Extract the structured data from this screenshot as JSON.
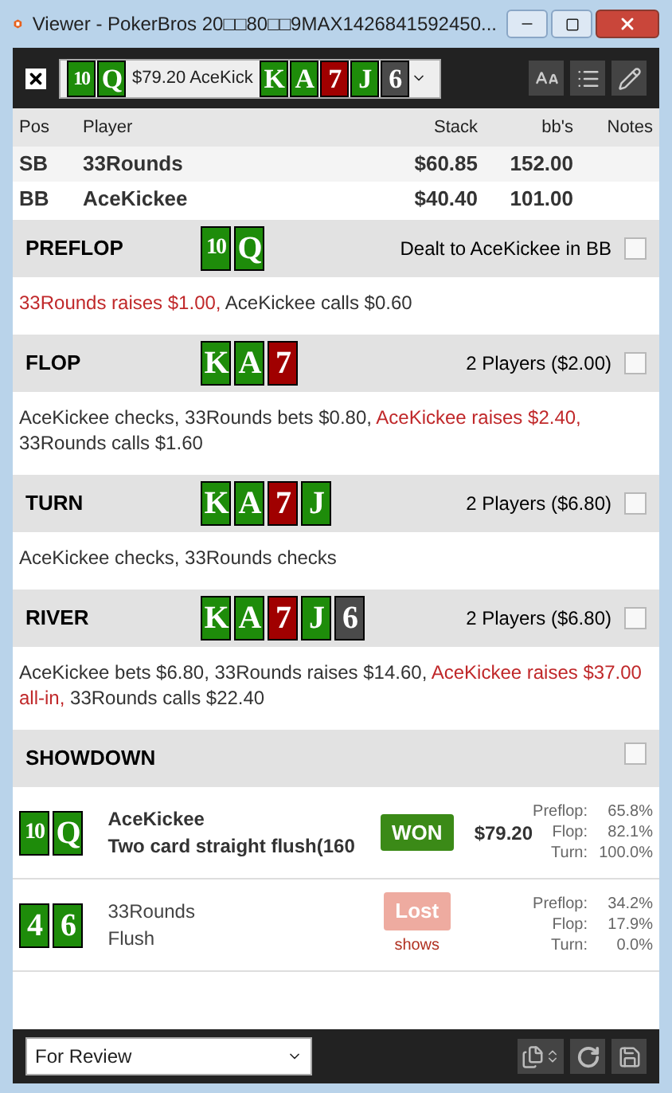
{
  "window": {
    "title": "Viewer - PokerBros 20□□80□□9MAX1426841592450..."
  },
  "toolbar": {
    "hand_selector": {
      "hole_cards": [
        {
          "rank": "10",
          "color": "#1e8c0a"
        },
        {
          "rank": "Q",
          "color": "#1e8c0a"
        }
      ],
      "label": "$79.20 AceKick",
      "board": [
        {
          "rank": "K",
          "color": "#1e8c0a"
        },
        {
          "rank": "A",
          "color": "#1e8c0a"
        },
        {
          "rank": "7",
          "color": "#a00000"
        },
        {
          "rank": "J",
          "color": "#1e8c0a"
        },
        {
          "rank": "6",
          "color": "#4a4a4a"
        }
      ]
    }
  },
  "players_table": {
    "columns": [
      "Pos",
      "Player",
      "Stack",
      "bb's",
      "Notes"
    ],
    "rows": [
      {
        "pos": "SB",
        "player": "33Rounds",
        "stack": "$60.85",
        "bbs": "152.00"
      },
      {
        "pos": "BB",
        "player": "AceKickee",
        "stack": "$40.40",
        "bbs": "101.00"
      }
    ]
  },
  "streets": [
    {
      "name": "PREFLOP",
      "cards": [
        {
          "rank": "10",
          "color": "#1e8c0a"
        },
        {
          "rank": "Q",
          "color": "#1e8c0a"
        }
      ],
      "summary": "Dealt to AceKickee in BB",
      "notes_checked": false,
      "actions": [
        {
          "text": "33Rounds raises $1.00,",
          "highlight": true
        },
        {
          "text": "AceKickee calls $0.60",
          "highlight": false
        }
      ]
    },
    {
      "name": "FLOP",
      "cards": [
        {
          "rank": "K",
          "color": "#1e8c0a"
        },
        {
          "rank": "A",
          "color": "#1e8c0a"
        },
        {
          "rank": "7",
          "color": "#a00000"
        }
      ],
      "summary": "2 Players ($2.00)",
      "notes_checked": false,
      "actions": [
        {
          "text": "AceKickee checks, 33Rounds bets $0.80,",
          "highlight": false
        },
        {
          "text": "AceKickee raises $2.40,",
          "highlight": true
        },
        {
          "text": "33Rounds calls $1.60",
          "highlight": false
        }
      ]
    },
    {
      "name": "TURN",
      "cards": [
        {
          "rank": "K",
          "color": "#1e8c0a"
        },
        {
          "rank": "A",
          "color": "#1e8c0a"
        },
        {
          "rank": "7",
          "color": "#a00000"
        },
        {
          "rank": "J",
          "color": "#1e8c0a"
        }
      ],
      "summary": "2 Players ($6.80)",
      "notes_checked": false,
      "actions": [
        {
          "text": "AceKickee checks, 33Rounds checks",
          "highlight": false
        }
      ]
    },
    {
      "name": "RIVER",
      "cards": [
        {
          "rank": "K",
          "color": "#1e8c0a"
        },
        {
          "rank": "A",
          "color": "#1e8c0a"
        },
        {
          "rank": "7",
          "color": "#a00000"
        },
        {
          "rank": "J",
          "color": "#1e8c0a"
        },
        {
          "rank": "6",
          "color": "#4a4a4a"
        }
      ],
      "summary": "2 Players ($6.80)",
      "notes_checked": false,
      "actions": [
        {
          "text": "AceKickee bets $6.80, 33Rounds raises $14.60,",
          "highlight": false
        },
        {
          "text": "AceKickee raises $37.00 all-in,",
          "highlight": true
        },
        {
          "text": "33Rounds calls $22.40",
          "highlight": false
        }
      ]
    }
  ],
  "showdown": {
    "name": "SHOWDOWN",
    "notes_checked": false,
    "results": [
      {
        "cards": [
          {
            "rank": "10",
            "color": "#1e8c0a"
          },
          {
            "rank": "Q",
            "color": "#1e8c0a"
          }
        ],
        "player": "AceKickee",
        "hand": "Two card straight flush(160",
        "won": true,
        "badge": "WON",
        "amount": "$79.20",
        "equities": [
          {
            "label": "Preflop:",
            "value": "65.8%"
          },
          {
            "label": "Flop:",
            "value": "82.1%"
          },
          {
            "label": "Turn:",
            "value": "100.0%"
          }
        ]
      },
      {
        "cards": [
          {
            "rank": "4",
            "color": "#1e8c0a"
          },
          {
            "rank": "6",
            "color": "#1e8c0a"
          }
        ],
        "player": "33Rounds",
        "hand": "Flush",
        "won": false,
        "badge": "Lost",
        "note": "shows",
        "equities": [
          {
            "label": "Preflop:",
            "value": "34.2%"
          },
          {
            "label": "Flop:",
            "value": "17.9%"
          },
          {
            "label": "Turn:",
            "value": "0.0%"
          }
        ]
      }
    ]
  },
  "bottom_bar": {
    "filter": {
      "value": "For Review"
    }
  }
}
